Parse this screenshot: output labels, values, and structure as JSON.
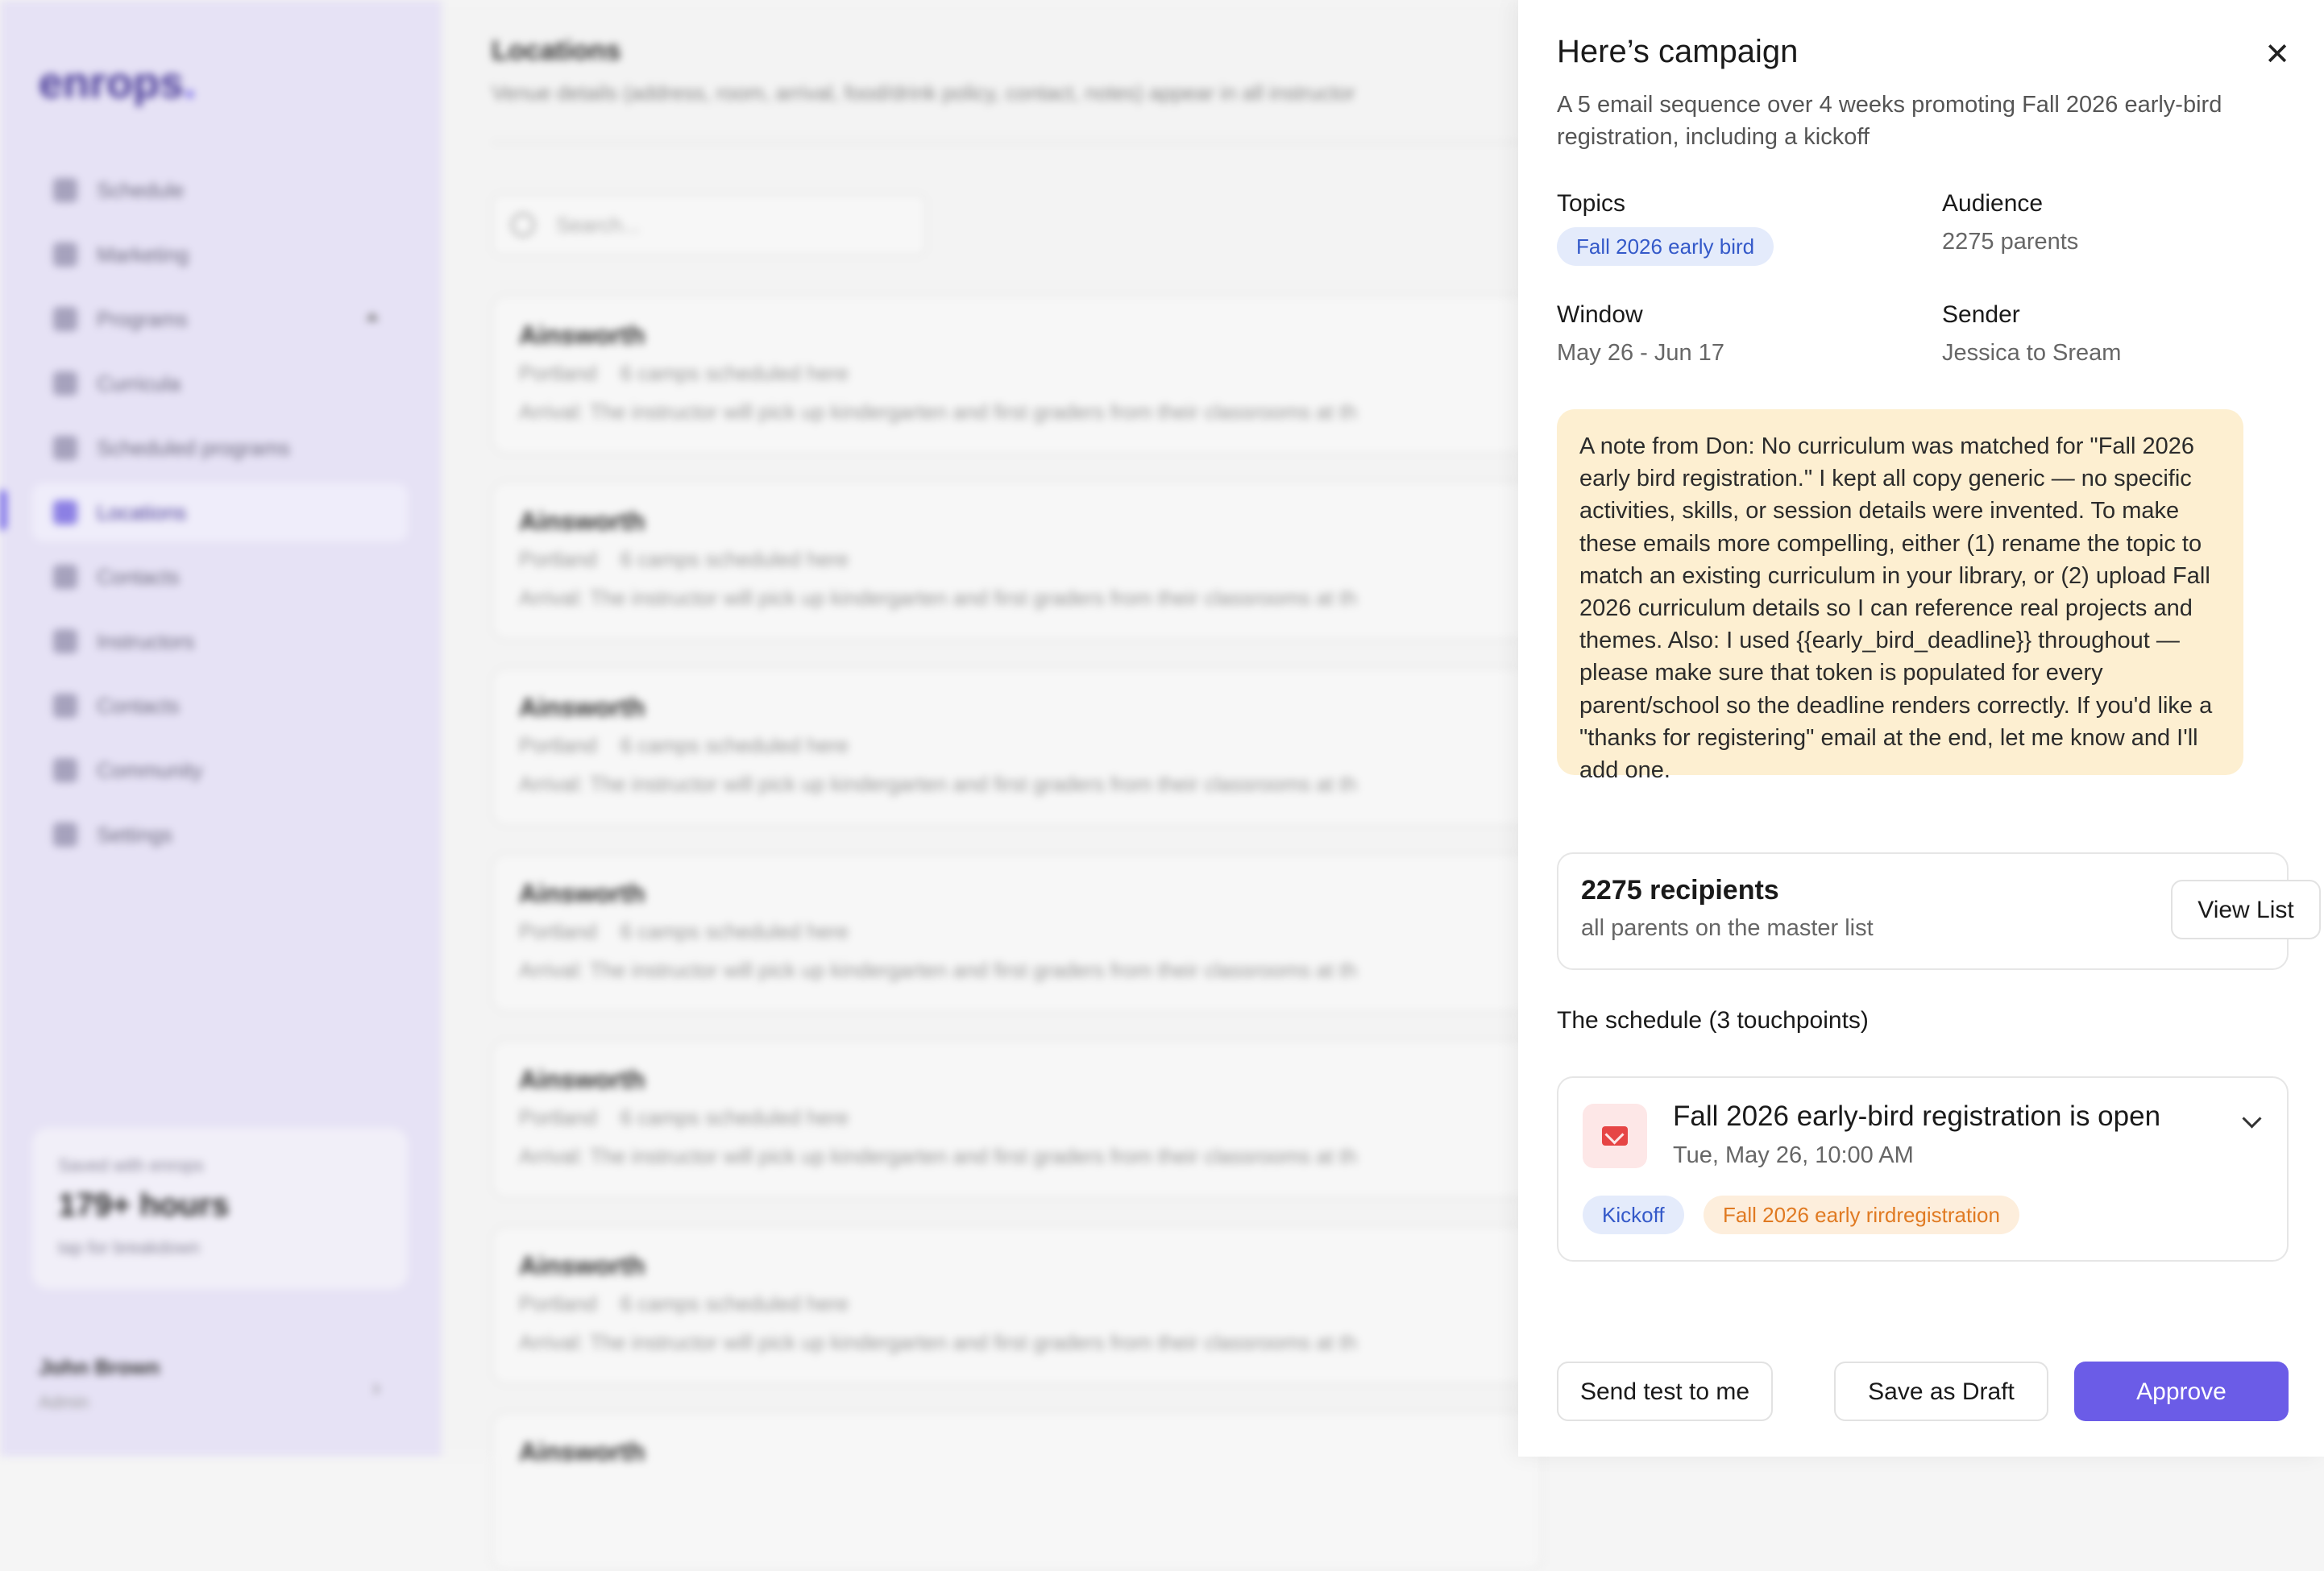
{
  "sidebar": {
    "logo": "enrops",
    "logo_dot": ".",
    "items": [
      {
        "label": "Schedule"
      },
      {
        "label": "Marketing"
      },
      {
        "label": "Programs"
      },
      {
        "label": "Curricula"
      },
      {
        "label": "Scheduled programs"
      },
      {
        "label": "Locations"
      },
      {
        "label": "Contacts"
      },
      {
        "label": "Instructors"
      },
      {
        "label": "Contacts"
      },
      {
        "label": "Community"
      },
      {
        "label": "Settings"
      }
    ],
    "active_item": "Locations",
    "saved": {
      "label": "Saved with enrops",
      "value": "179+ hours",
      "sub": "tap for breakdown"
    },
    "user": {
      "name": "John Brown",
      "role": "Admin"
    }
  },
  "main": {
    "title": "Locations",
    "description": "Venue details (address, room, arrival, food/drink policy, contact, notes) appear in all instructor",
    "search_placeholder": "Search...",
    "locations": [
      {
        "name": "Ainsworth",
        "city": "Portland",
        "camps": "6 camps scheduled here",
        "arrival": "Arrival: The instructor will pick up kindergarten and first graders from their classrooms at th"
      },
      {
        "name": "Ainsworth",
        "city": "Portland",
        "camps": "6 camps scheduled here",
        "arrival": "Arrival: The instructor will pick up kindergarten and first graders from their classrooms at th"
      },
      {
        "name": "Ainsworth",
        "city": "Portland",
        "camps": "6 camps scheduled here",
        "arrival": "Arrival: The instructor will pick up kindergarten and first graders from their classrooms at th"
      },
      {
        "name": "Ainsworth",
        "city": "Portland",
        "camps": "6 camps scheduled here",
        "arrival": "Arrival: The instructor will pick up kindergarten and first graders from their classrooms at th"
      },
      {
        "name": "Ainsworth",
        "city": "Portland",
        "camps": "6 camps scheduled here",
        "arrival": "Arrival: The instructor will pick up kindergarten and first graders from their classrooms at th"
      },
      {
        "name": "Ainsworth",
        "city": "Portland",
        "camps": "6 camps scheduled here",
        "arrival": "Arrival: The instructor will pick up kindergarten and first graders from their classrooms at th"
      },
      {
        "name": "Ainsworth",
        "city": "",
        "camps": "",
        "arrival": ""
      }
    ]
  },
  "panel": {
    "title": "Here’s campaign",
    "description": "A 5 email sequence over 4 weeks promoting Fall 2026 early-bird registration, including a kickoff",
    "topics_label": "Topics",
    "topic": "Fall 2026 early bird",
    "audience_label": "Audience",
    "audience": "2275 parents",
    "window_label": "Window",
    "window": "May 26 - Jun 17",
    "sender_label": "Sender",
    "sender": "Jessica to Sream",
    "note": "A note from Don: No curriculum was matched for \"Fall 2026 early bird registration.\" I kept all copy generic — no specific activities, skills, or session details were invented. To make these emails more compelling, either (1) rename the topic to match an existing curriculum in your library, or (2) upload Fall 2026 curriculum details so I can reference real projects and themes. Also: I used {{early_bird_deadline}} throughout — please make sure that token is populated for every parent/school so the deadline renders correctly. If you'd like a \"thanks for registering\" email at the end, let me know and I'll add one.",
    "recipients": {
      "count": "2275 recipients",
      "sub": "all parents on the master list",
      "view_list": "View List"
    },
    "schedule_heading": "The schedule (3 touchpoints)",
    "touchpoint": {
      "title": "Fall 2026 early-bird registration is open",
      "date": "Tue, May 26, 10:00 AM",
      "tags": [
        "Kickoff",
        "Fall 2026 early rirdregistration"
      ]
    },
    "buttons": {
      "send_test": "Send test to me",
      "save_draft": "Save as Draft",
      "approve": "Approve"
    }
  },
  "colors": {
    "accent": "#6b5ce7",
    "note_bg": "#fdefd1",
    "topic_pill": "#e4ebfb",
    "tag_orange": "#e07a22"
  },
  "icons": [
    "close-icon",
    "mail-icon",
    "chevron-down-icon",
    "search-icon"
  ]
}
